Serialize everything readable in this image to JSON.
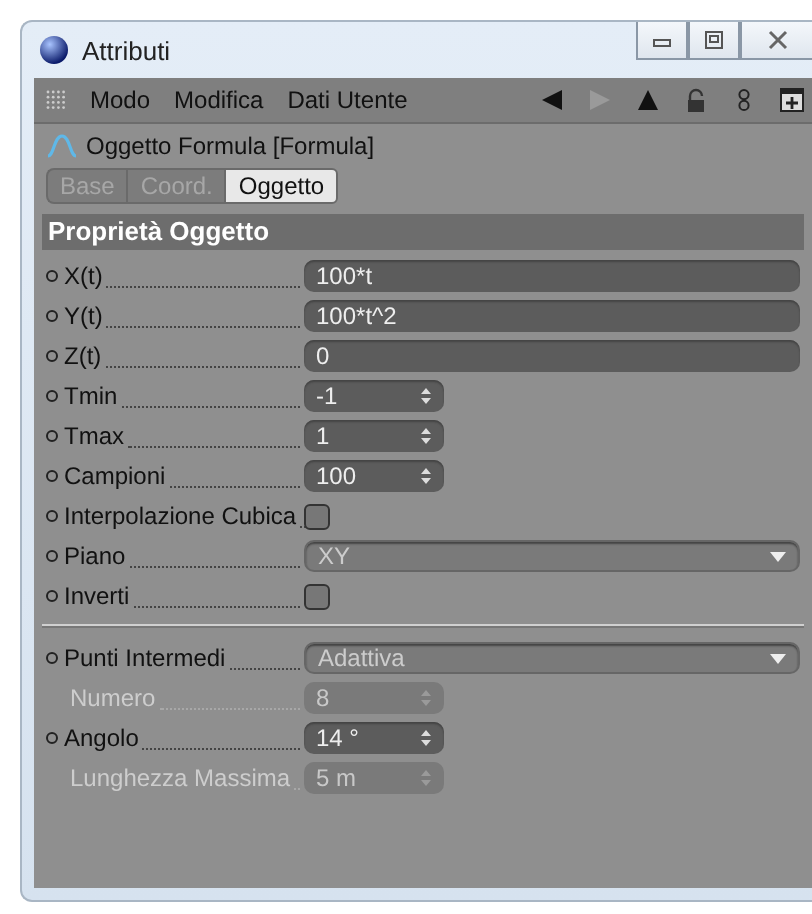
{
  "window": {
    "title": "Attributi"
  },
  "menu": [
    "Modo",
    "Modifica",
    "Dati Utente"
  ],
  "object": {
    "name": "Oggetto Formula [Formula]"
  },
  "tabs": [
    {
      "label": "Base",
      "selected": false
    },
    {
      "label": "Coord.",
      "selected": false
    },
    {
      "label": "Oggetto",
      "selected": true
    }
  ],
  "section": {
    "title": "Proprietà Oggetto"
  },
  "groups": [
    [
      {
        "label": "X(t)",
        "kind": "text",
        "value": "100*t",
        "disabled": false
      },
      {
        "label": "Y(t)",
        "kind": "text",
        "value": "100*t^2",
        "disabled": false
      },
      {
        "label": "Z(t)",
        "kind": "text",
        "value": "0",
        "disabled": false
      },
      {
        "label": "Tmin",
        "kind": "number",
        "value": "-1",
        "disabled": false
      },
      {
        "label": "Tmax",
        "kind": "number",
        "value": "1",
        "disabled": false
      },
      {
        "label": "Campioni",
        "kind": "number",
        "value": "100",
        "disabled": false
      },
      {
        "label": "Interpolazione Cubica",
        "kind": "checkbox",
        "checked": false,
        "disabled": false
      },
      {
        "label": "Piano",
        "kind": "dropdown",
        "value": "XY",
        "disabled": false
      },
      {
        "label": "Inverti",
        "kind": "checkbox",
        "checked": false,
        "disabled": false
      }
    ],
    [
      {
        "label": "Punti Intermedi",
        "kind": "dropdown",
        "value": "Adattiva",
        "disabled": false
      },
      {
        "label": "Numero",
        "kind": "number",
        "value": "8",
        "disabled": true
      },
      {
        "label": "Angolo",
        "kind": "number",
        "value": "14 °",
        "disabled": false
      },
      {
        "label": "Lunghezza Massima",
        "kind": "number",
        "value": "5 m",
        "disabled": true
      }
    ]
  ]
}
